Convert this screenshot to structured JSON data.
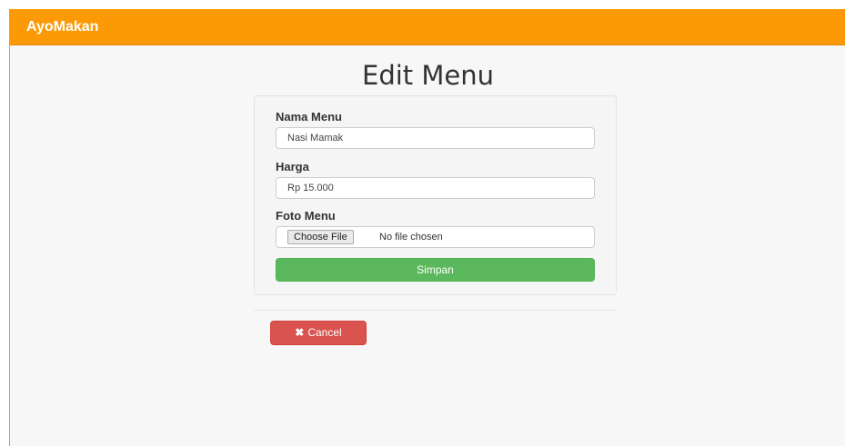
{
  "app": {
    "brand": "AyoMakan"
  },
  "page": {
    "title": "Edit Menu"
  },
  "form": {
    "name_label": "Nama Menu",
    "name_value": "Nasi Mamak",
    "price_label": "Harga",
    "price_value": "Rp 15.000",
    "photo_label": "Foto Menu",
    "file_button_label": "Choose File",
    "file_status": "No file chosen",
    "submit_label": "Simpan"
  },
  "actions": {
    "cancel_label": "Cancel",
    "cancel_icon": "times-icon"
  },
  "colors": {
    "navbar": "#fb9a06",
    "submit": "#5cb85c",
    "cancel": "#d9534f"
  }
}
